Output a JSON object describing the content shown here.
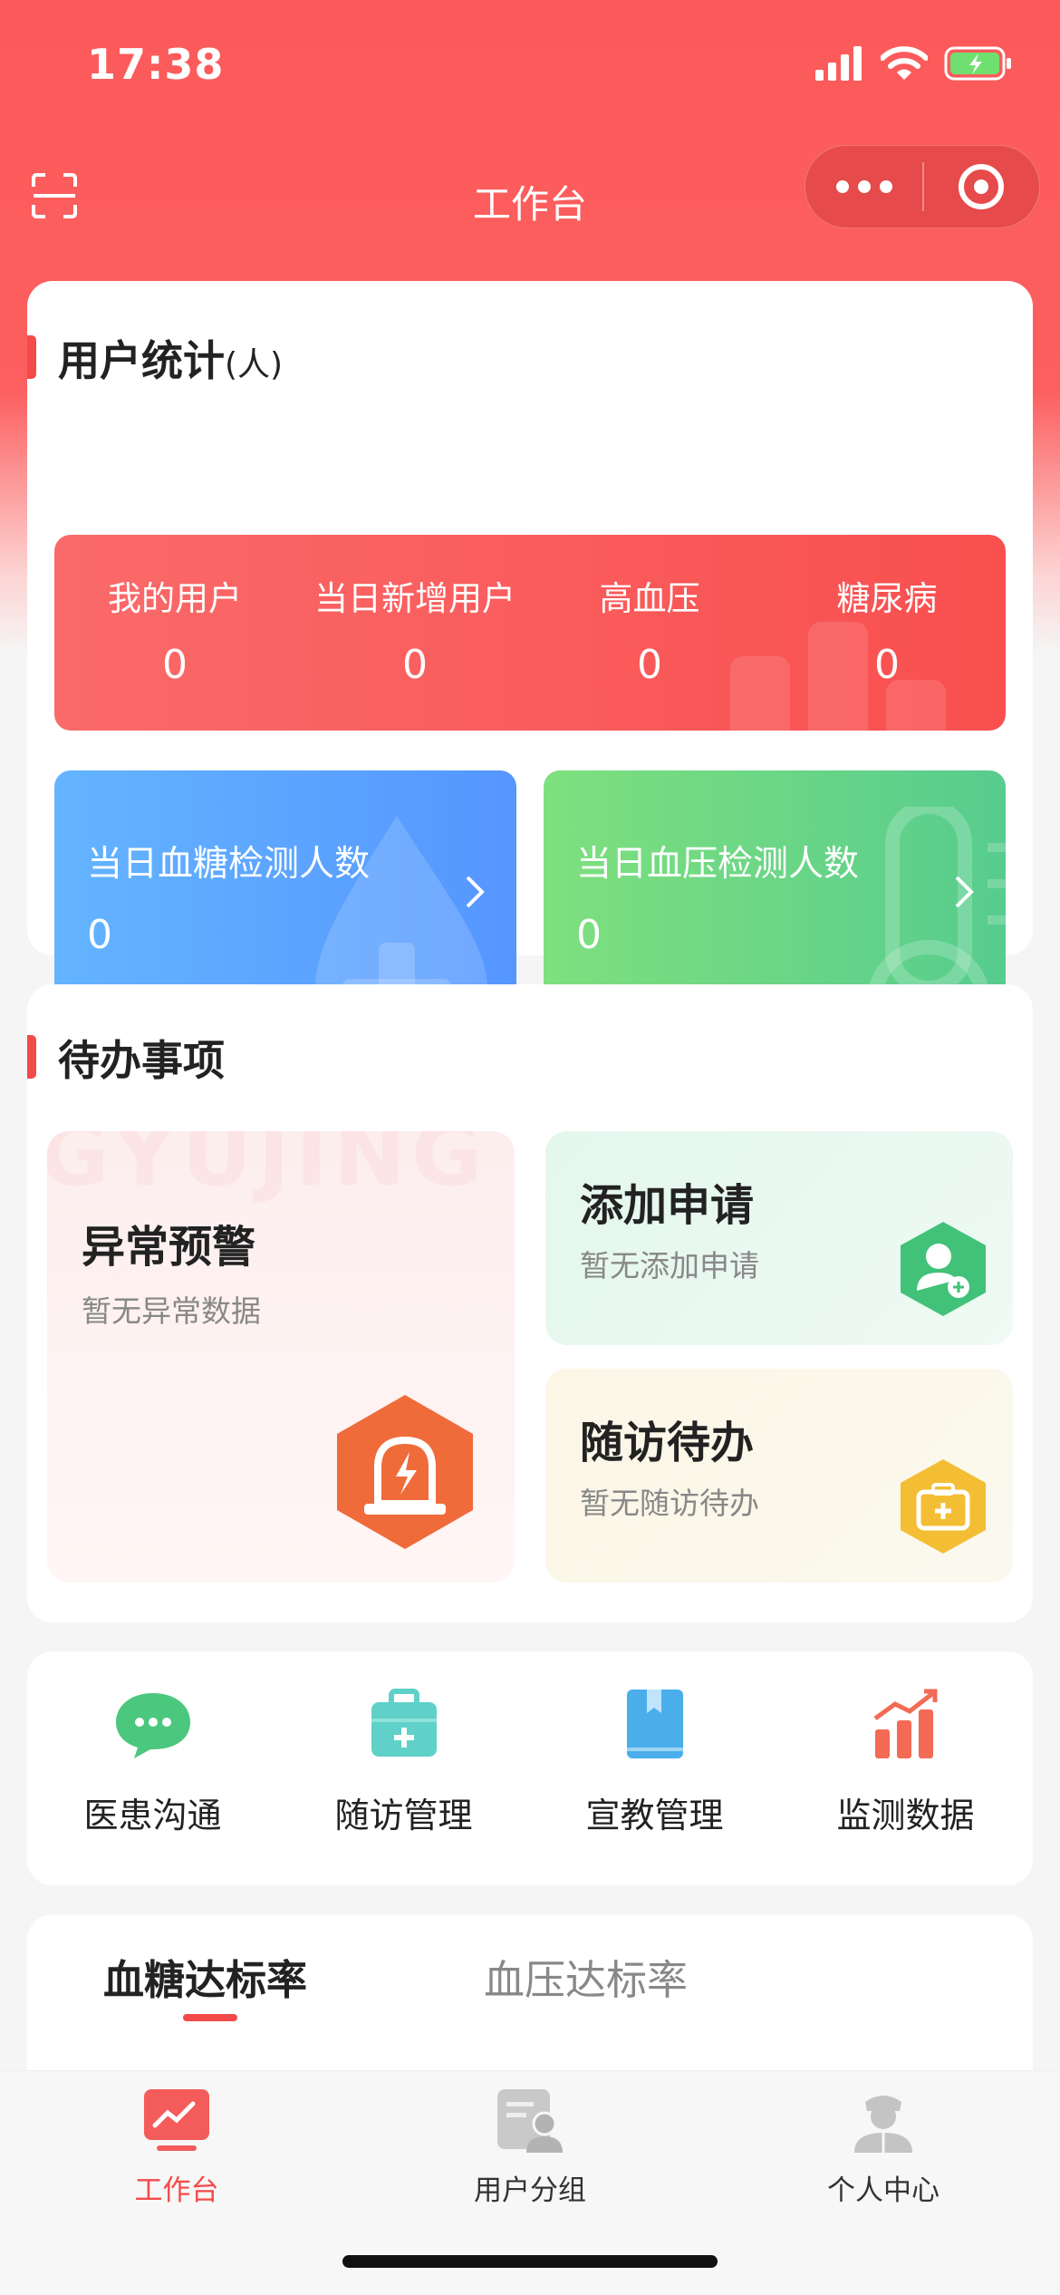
{
  "status_bar": {
    "time": "17:38"
  },
  "nav": {
    "title": "工作台"
  },
  "user_stats": {
    "title": "用户统计",
    "unit": "(人)",
    "items": [
      {
        "label": "我的用户",
        "value": "0"
      },
      {
        "label": "当日新增用户",
        "value": "0"
      },
      {
        "label": "高血压",
        "value": "0"
      },
      {
        "label": "糖尿病",
        "value": "0"
      }
    ],
    "glucose_tile": {
      "label": "当日血糖检测人数",
      "value": "0"
    },
    "pressure_tile": {
      "label": "当日血压检测人数",
      "value": "0"
    }
  },
  "todo": {
    "title": "待办事项",
    "watermark": "GYUJING",
    "alert": {
      "title": "异常预警",
      "subtitle": "暂无异常数据"
    },
    "apply": {
      "title": "添加申请",
      "subtitle": "暂无添加申请"
    },
    "followup": {
      "title": "随访待办",
      "subtitle": "暂无随访待办"
    }
  },
  "quick_actions": [
    {
      "label": "医患沟通"
    },
    {
      "label": "随访管理"
    },
    {
      "label": "宣教管理"
    },
    {
      "label": "监测数据"
    }
  ],
  "rate_tabs": [
    {
      "label": "血糖达标率",
      "active": true
    },
    {
      "label": "血压达标率",
      "active": false
    }
  ],
  "bottom_nav": [
    {
      "label": "工作台",
      "active": true
    },
    {
      "label": "用户分组",
      "active": false
    },
    {
      "label": "个人中心",
      "active": false
    }
  ],
  "colors": {
    "brand": "#f44a4a",
    "blue": "#5aa2ff",
    "green": "#5ed08c"
  }
}
